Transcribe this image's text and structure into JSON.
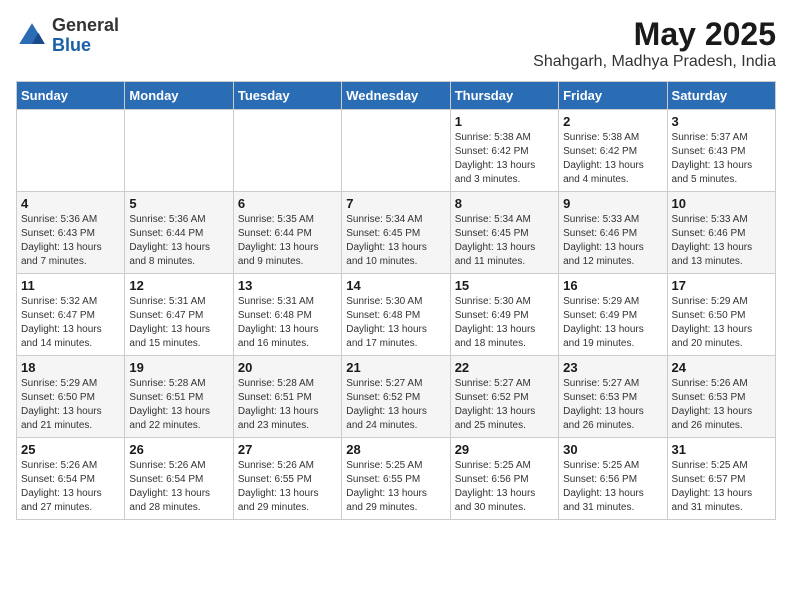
{
  "logo": {
    "general": "General",
    "blue": "Blue"
  },
  "title": "May 2025",
  "subtitle": "Shahgarh, Madhya Pradesh, India",
  "headers": [
    "Sunday",
    "Monday",
    "Tuesday",
    "Wednesday",
    "Thursday",
    "Friday",
    "Saturday"
  ],
  "weeks": [
    [
      {
        "day": "",
        "info": ""
      },
      {
        "day": "",
        "info": ""
      },
      {
        "day": "",
        "info": ""
      },
      {
        "day": "",
        "info": ""
      },
      {
        "day": "1",
        "info": "Sunrise: 5:38 AM\nSunset: 6:42 PM\nDaylight: 13 hours\nand 3 minutes."
      },
      {
        "day": "2",
        "info": "Sunrise: 5:38 AM\nSunset: 6:42 PM\nDaylight: 13 hours\nand 4 minutes."
      },
      {
        "day": "3",
        "info": "Sunrise: 5:37 AM\nSunset: 6:43 PM\nDaylight: 13 hours\nand 5 minutes."
      }
    ],
    [
      {
        "day": "4",
        "info": "Sunrise: 5:36 AM\nSunset: 6:43 PM\nDaylight: 13 hours\nand 7 minutes."
      },
      {
        "day": "5",
        "info": "Sunrise: 5:36 AM\nSunset: 6:44 PM\nDaylight: 13 hours\nand 8 minutes."
      },
      {
        "day": "6",
        "info": "Sunrise: 5:35 AM\nSunset: 6:44 PM\nDaylight: 13 hours\nand 9 minutes."
      },
      {
        "day": "7",
        "info": "Sunrise: 5:34 AM\nSunset: 6:45 PM\nDaylight: 13 hours\nand 10 minutes."
      },
      {
        "day": "8",
        "info": "Sunrise: 5:34 AM\nSunset: 6:45 PM\nDaylight: 13 hours\nand 11 minutes."
      },
      {
        "day": "9",
        "info": "Sunrise: 5:33 AM\nSunset: 6:46 PM\nDaylight: 13 hours\nand 12 minutes."
      },
      {
        "day": "10",
        "info": "Sunrise: 5:33 AM\nSunset: 6:46 PM\nDaylight: 13 hours\nand 13 minutes."
      }
    ],
    [
      {
        "day": "11",
        "info": "Sunrise: 5:32 AM\nSunset: 6:47 PM\nDaylight: 13 hours\nand 14 minutes."
      },
      {
        "day": "12",
        "info": "Sunrise: 5:31 AM\nSunset: 6:47 PM\nDaylight: 13 hours\nand 15 minutes."
      },
      {
        "day": "13",
        "info": "Sunrise: 5:31 AM\nSunset: 6:48 PM\nDaylight: 13 hours\nand 16 minutes."
      },
      {
        "day": "14",
        "info": "Sunrise: 5:30 AM\nSunset: 6:48 PM\nDaylight: 13 hours\nand 17 minutes."
      },
      {
        "day": "15",
        "info": "Sunrise: 5:30 AM\nSunset: 6:49 PM\nDaylight: 13 hours\nand 18 minutes."
      },
      {
        "day": "16",
        "info": "Sunrise: 5:29 AM\nSunset: 6:49 PM\nDaylight: 13 hours\nand 19 minutes."
      },
      {
        "day": "17",
        "info": "Sunrise: 5:29 AM\nSunset: 6:50 PM\nDaylight: 13 hours\nand 20 minutes."
      }
    ],
    [
      {
        "day": "18",
        "info": "Sunrise: 5:29 AM\nSunset: 6:50 PM\nDaylight: 13 hours\nand 21 minutes."
      },
      {
        "day": "19",
        "info": "Sunrise: 5:28 AM\nSunset: 6:51 PM\nDaylight: 13 hours\nand 22 minutes."
      },
      {
        "day": "20",
        "info": "Sunrise: 5:28 AM\nSunset: 6:51 PM\nDaylight: 13 hours\nand 23 minutes."
      },
      {
        "day": "21",
        "info": "Sunrise: 5:27 AM\nSunset: 6:52 PM\nDaylight: 13 hours\nand 24 minutes."
      },
      {
        "day": "22",
        "info": "Sunrise: 5:27 AM\nSunset: 6:52 PM\nDaylight: 13 hours\nand 25 minutes."
      },
      {
        "day": "23",
        "info": "Sunrise: 5:27 AM\nSunset: 6:53 PM\nDaylight: 13 hours\nand 26 minutes."
      },
      {
        "day": "24",
        "info": "Sunrise: 5:26 AM\nSunset: 6:53 PM\nDaylight: 13 hours\nand 26 minutes."
      }
    ],
    [
      {
        "day": "25",
        "info": "Sunrise: 5:26 AM\nSunset: 6:54 PM\nDaylight: 13 hours\nand 27 minutes."
      },
      {
        "day": "26",
        "info": "Sunrise: 5:26 AM\nSunset: 6:54 PM\nDaylight: 13 hours\nand 28 minutes."
      },
      {
        "day": "27",
        "info": "Sunrise: 5:26 AM\nSunset: 6:55 PM\nDaylight: 13 hours\nand 29 minutes."
      },
      {
        "day": "28",
        "info": "Sunrise: 5:25 AM\nSunset: 6:55 PM\nDaylight: 13 hours\nand 29 minutes."
      },
      {
        "day": "29",
        "info": "Sunrise: 5:25 AM\nSunset: 6:56 PM\nDaylight: 13 hours\nand 30 minutes."
      },
      {
        "day": "30",
        "info": "Sunrise: 5:25 AM\nSunset: 6:56 PM\nDaylight: 13 hours\nand 31 minutes."
      },
      {
        "day": "31",
        "info": "Sunrise: 5:25 AM\nSunset: 6:57 PM\nDaylight: 13 hours\nand 31 minutes."
      }
    ]
  ]
}
